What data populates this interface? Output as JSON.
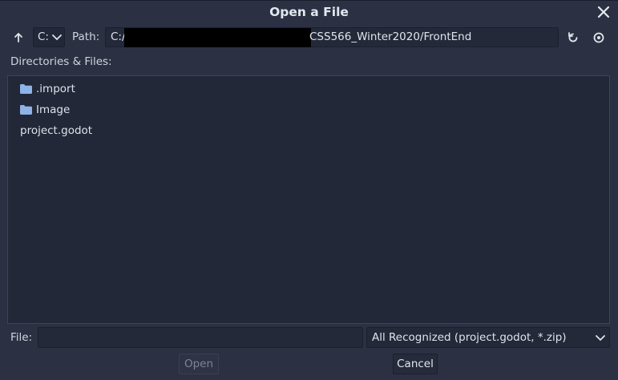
{
  "dialog": {
    "title": "Open a File"
  },
  "toolbar": {
    "drive": "C:",
    "path_label": "Path:",
    "path_prefix": "C:/",
    "path_suffix": "CSS566_Winter2020/FrontEnd"
  },
  "files": {
    "section_label": "Directories & Files:",
    "items": [
      {
        "name": ".import",
        "type": "folder"
      },
      {
        "name": "Image",
        "type": "folder"
      },
      {
        "name": "project.godot",
        "type": "file"
      }
    ]
  },
  "footer": {
    "file_label": "File:",
    "file_value": "",
    "filter": "All Recognized (project.godot, *.zip)",
    "open_label": "Open",
    "cancel_label": "Cancel"
  },
  "icons": {
    "folder_color": "#8fb3e8",
    "accent": "#dfe3ea"
  }
}
